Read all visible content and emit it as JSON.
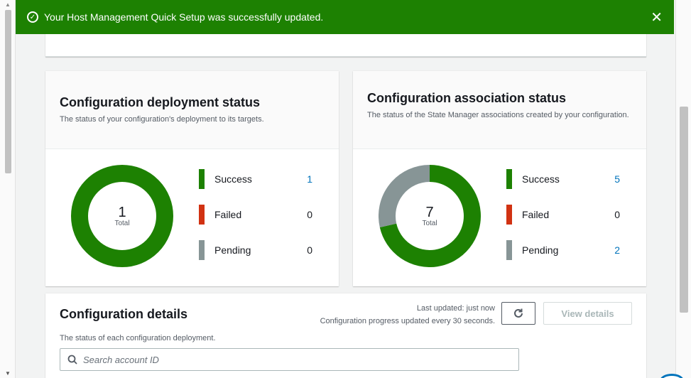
{
  "flash": {
    "message": "Your Host Management Quick Setup was successfully updated.",
    "close_glyph": "✕",
    "check_glyph": "✓"
  },
  "deployment": {
    "title": "Configuration deployment status",
    "subtitle": "The status of your configuration's deployment to its targets.",
    "total": "1",
    "total_label": "Total",
    "legend": [
      {
        "label": "Success",
        "value": "1",
        "color": "#1d8102",
        "link": true
      },
      {
        "label": "Failed",
        "value": "0",
        "color": "#d13212",
        "link": false
      },
      {
        "label": "Pending",
        "value": "0",
        "color": "#879596",
        "link": false
      }
    ]
  },
  "association": {
    "title": "Configuration association status",
    "subtitle": "The status of the State Manager associations created by your configuration.",
    "total": "7",
    "total_label": "Total",
    "legend": [
      {
        "label": "Success",
        "value": "5",
        "color": "#1d8102",
        "link": true
      },
      {
        "label": "Failed",
        "value": "0",
        "color": "#d13212",
        "link": false
      },
      {
        "label": "Pending",
        "value": "2",
        "color": "#879596",
        "link": true
      }
    ]
  },
  "details": {
    "title": "Configuration details",
    "subtitle": "The status of each configuration deployment.",
    "last_updated": "Last updated: just now",
    "progress_note": "Configuration progress updated every 30 seconds.",
    "refresh_glyph": "↻",
    "view_details_label": "View details",
    "search_placeholder": "Search account ID"
  },
  "colors": {
    "success": "#1d8102",
    "failed": "#d13212",
    "pending": "#879596",
    "link": "#0073bb"
  }
}
